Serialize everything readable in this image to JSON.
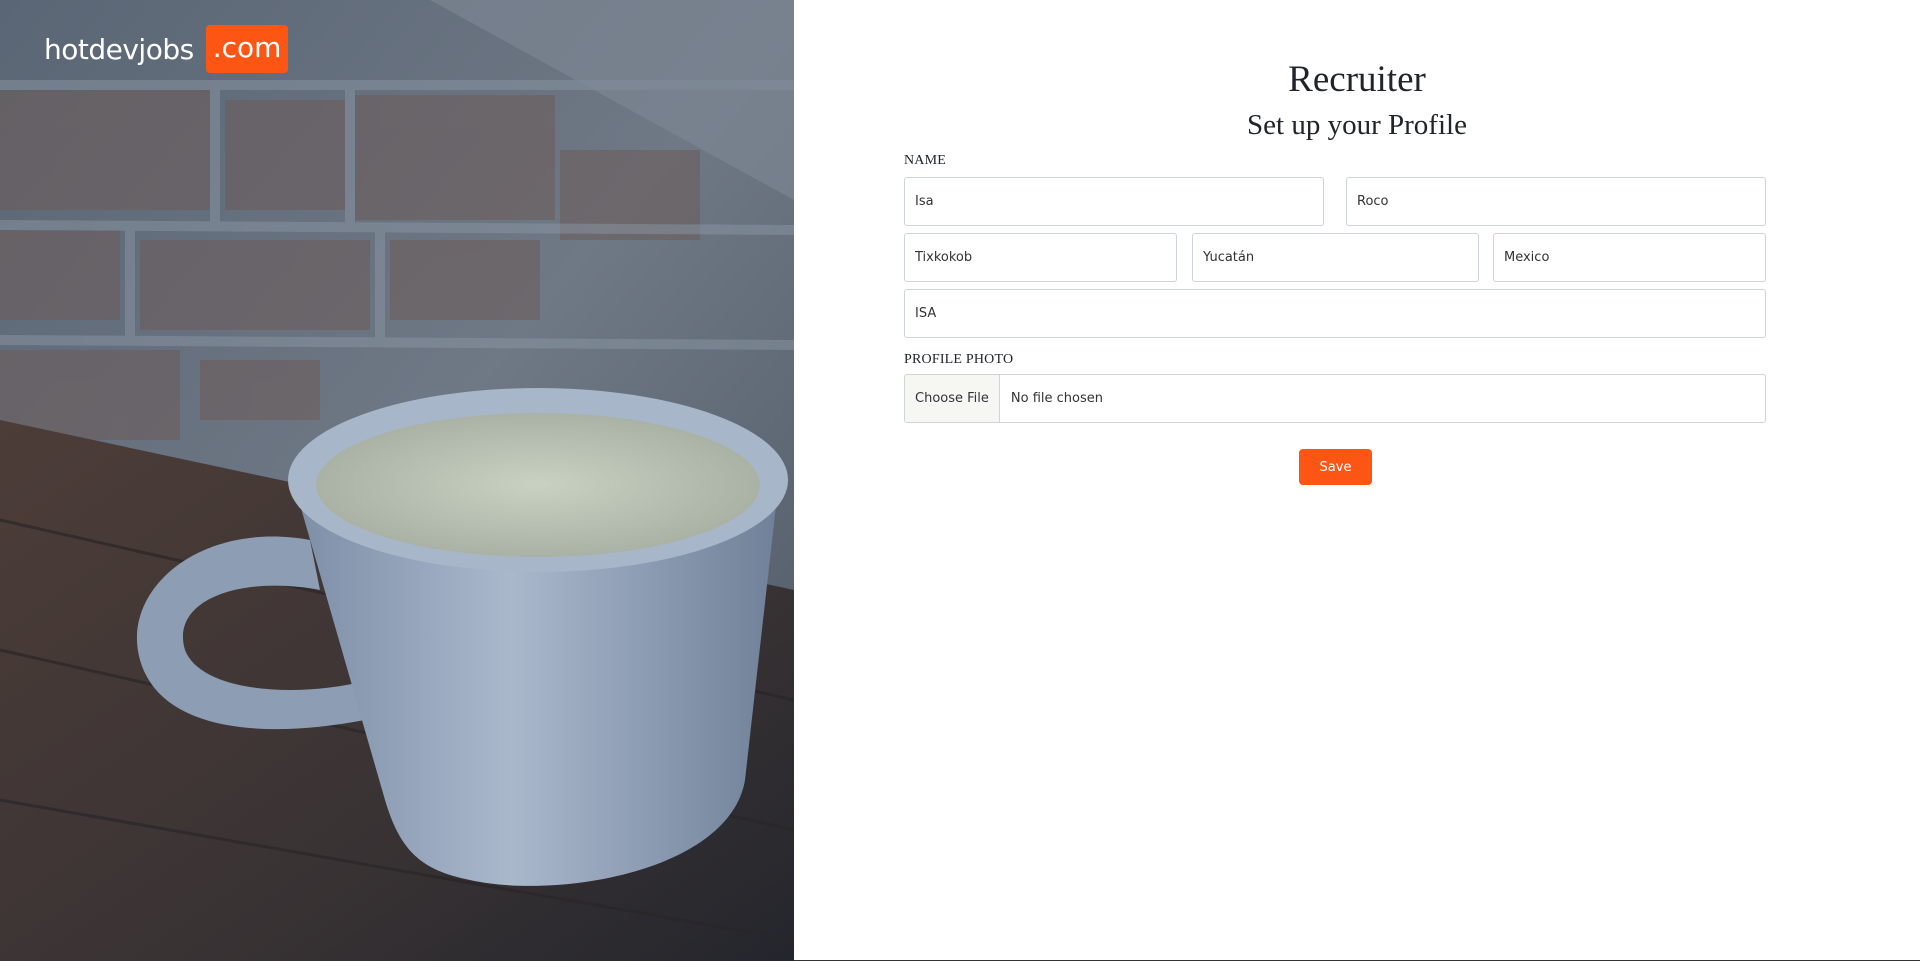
{
  "brand": {
    "name": "hotdevjobs",
    "tld": ".com",
    "accent_color": "#fd5614"
  },
  "background_image": {
    "subject": "white-coffee-cup-on-wood-table-against-brick-wall"
  },
  "form": {
    "title": "Recruiter",
    "subtitle": "Set up your Profile",
    "name_label": "NAME",
    "first_name": "Isa",
    "last_name": "Roco",
    "city": "Tixkokob",
    "state": "Yucatán",
    "country": "Mexico",
    "company": "ISA",
    "photo_label": "PROFILE PHOTO",
    "file_button_label": "Choose File",
    "file_status": "No file chosen",
    "save_label": "Save"
  }
}
